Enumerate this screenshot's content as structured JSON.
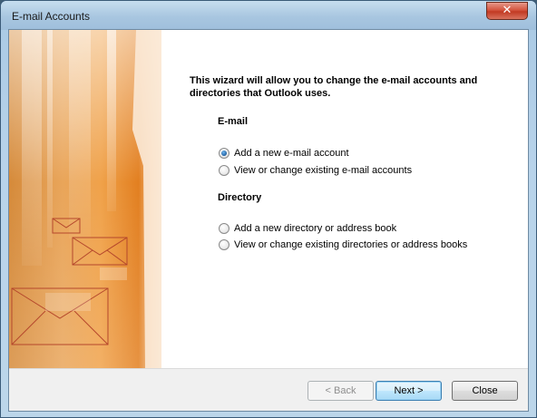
{
  "window": {
    "title": "E-mail Accounts",
    "close_glyph": "✕"
  },
  "wizard": {
    "intro": "This wizard will allow you to change the e-mail accounts and directories that Outlook uses."
  },
  "email_section": {
    "title": "E-mail",
    "options": [
      {
        "label": "Add a new e-mail account",
        "checked": true
      },
      {
        "label": "View or change existing e-mail accounts",
        "checked": false
      }
    ]
  },
  "directory_section": {
    "title": "Directory",
    "options": [
      {
        "label": "Add a new directory or address book",
        "checked": false
      },
      {
        "label": "View or change existing directories or address books",
        "checked": false
      }
    ]
  },
  "buttons": {
    "back": "< Back",
    "next": "Next >",
    "close": "Close"
  },
  "colors": {
    "art_orange": "#e88f2e",
    "envelope_stroke": "#b5472c"
  }
}
